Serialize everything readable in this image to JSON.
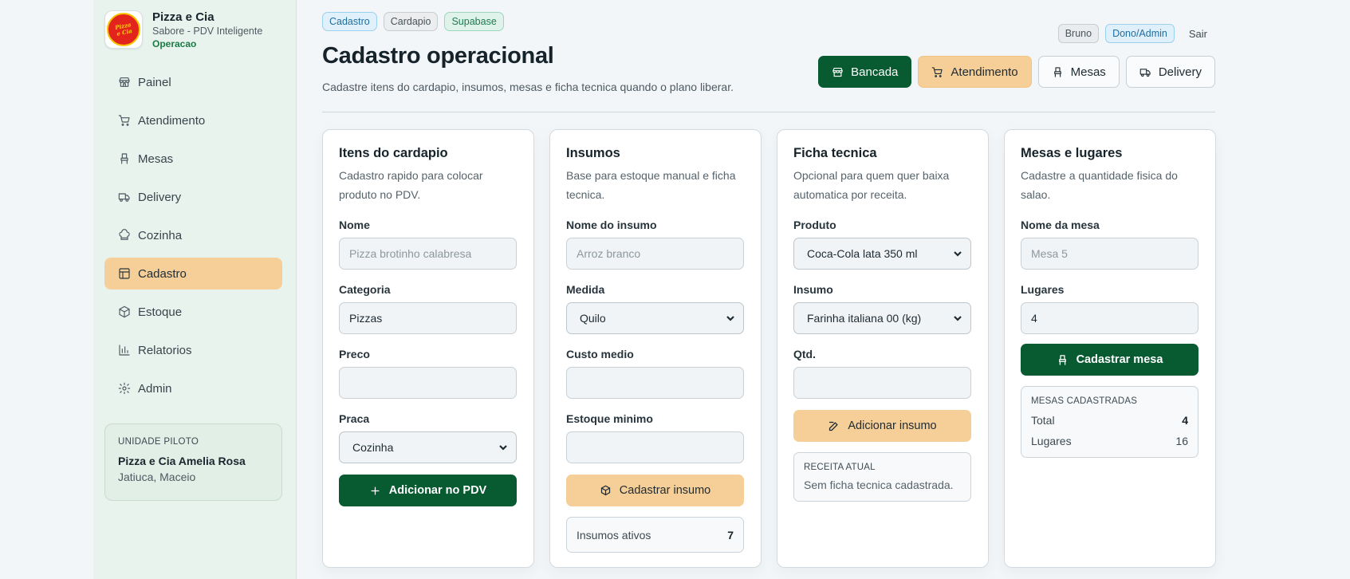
{
  "brand": {
    "name": "Pizza e Cia",
    "subtitle": "Sabore - PDV Inteligente",
    "status": "Operacao",
    "logo_text": "Pizza e Cia"
  },
  "nav": [
    {
      "label": "Painel",
      "icon": "store-icon"
    },
    {
      "label": "Atendimento",
      "icon": "cart-icon"
    },
    {
      "label": "Mesas",
      "icon": "chair-icon"
    },
    {
      "label": "Delivery",
      "icon": "truck-icon"
    },
    {
      "label": "Cozinha",
      "icon": "chef-hat-icon"
    },
    {
      "label": "Cadastro",
      "icon": "table-icon",
      "active": true
    },
    {
      "label": "Estoque",
      "icon": "box-icon"
    },
    {
      "label": "Relatorios",
      "icon": "bar-chart-icon"
    },
    {
      "label": "Admin",
      "icon": "gear-icon"
    }
  ],
  "unit": {
    "label": "UNIDADE PILOTO",
    "name": "Pizza e Cia Amelia Rosa",
    "location": "Jatiuca, Maceio"
  },
  "header": {
    "chips": [
      "Cadastro",
      "Cardapio",
      "Supabase"
    ],
    "title": "Cadastro operacional",
    "subtitle": "Cadastre itens do cardapio, insumos, mesas e ficha tecnica quando o plano liberar.",
    "user": "Bruno",
    "role": "Dono/Admin",
    "logout": "Sair",
    "actions": [
      "Bancada",
      "Atendimento",
      "Mesas",
      "Delivery"
    ]
  },
  "cards": {
    "menu": {
      "title": "Itens do cardapio",
      "desc": "Cadastro rapido para colocar produto no PDV.",
      "name_label": "Nome",
      "name_placeholder": "Pizza brotinho calabresa",
      "category_label": "Categoria",
      "category_value": "Pizzas",
      "price_label": "Preco",
      "price_value": "",
      "station_label": "Praca",
      "station_value": "Cozinha",
      "button": "Adicionar no PDV"
    },
    "supplies": {
      "title": "Insumos",
      "desc": "Base para estoque manual e ficha tecnica.",
      "name_label": "Nome do insumo",
      "name_placeholder": "Arroz branco",
      "unit_label": "Medida",
      "unit_value": "Quilo",
      "cost_label": "Custo medio",
      "cost_value": "",
      "min_label": "Estoque minimo",
      "min_value": "",
      "button": "Cadastrar insumo",
      "active_label": "Insumos ativos",
      "active_count": "7"
    },
    "recipe": {
      "title": "Ficha tecnica",
      "desc": "Opcional para quem quer baixa automatica por receita.",
      "product_label": "Produto",
      "product_value": "Coca-Cola lata 350 ml",
      "supply_label": "Insumo",
      "supply_value": "Farinha italiana 00 (kg)",
      "qty_label": "Qtd.",
      "qty_value": "",
      "button": "Adicionar insumo",
      "current_label": "RECEITA ATUAL",
      "current_text": "Sem ficha tecnica cadastrada."
    },
    "tables": {
      "title": "Mesas e lugares",
      "desc": "Cadastre a quantidade fisica do salao.",
      "name_label": "Nome da mesa",
      "name_placeholder": "Mesa 5",
      "seats_label": "Lugares",
      "seats_value": "4",
      "button": "Cadastrar mesa",
      "summary_label": "MESAS CADASTRADAS",
      "total_label": "Total",
      "total_value": "4",
      "seats_total_label": "Lugares",
      "seats_total_value": "16"
    }
  },
  "colors": {
    "accent_green": "#085a30",
    "accent_peach": "#f6cf98",
    "sidebar_bg": "#e7f3ec"
  }
}
